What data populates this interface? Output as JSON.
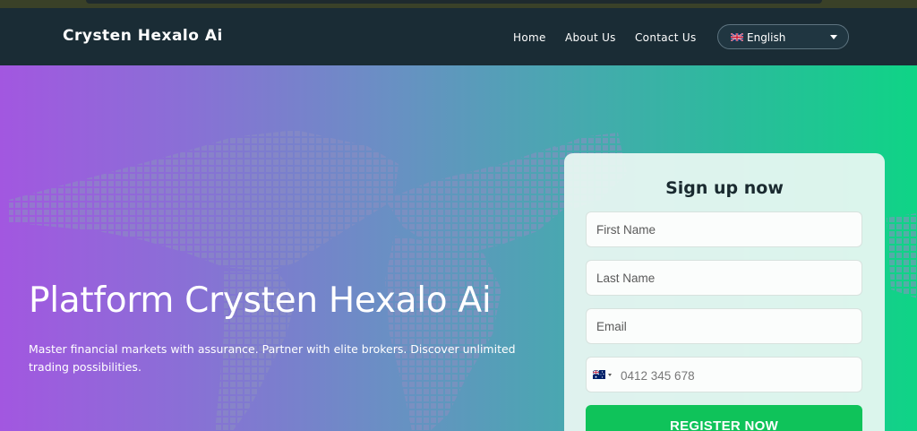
{
  "header": {
    "brand": "Crysten Hexalo Ai",
    "nav": [
      "Home",
      "About Us",
      "Contact Us"
    ],
    "language": "English"
  },
  "hero": {
    "title": "Platform Crysten Hexalo Ai",
    "subtitle": "Master financial markets with assurance. Partner with elite brokers. Discover unlimited trading possibilities."
  },
  "signup": {
    "title": "Sign up now",
    "first_name_placeholder": "First Name",
    "last_name_placeholder": "Last Name",
    "email_placeholder": "Email",
    "phone_placeholder": "0412 345 678",
    "country_flag": "australia-flag-icon",
    "register_label": "REGISTER NOW"
  },
  "colors": {
    "header_bg": "#1a2c35",
    "gradient_start": "#a257e0",
    "gradient_end": "#0fd486",
    "register_button": "#0fc35a"
  }
}
